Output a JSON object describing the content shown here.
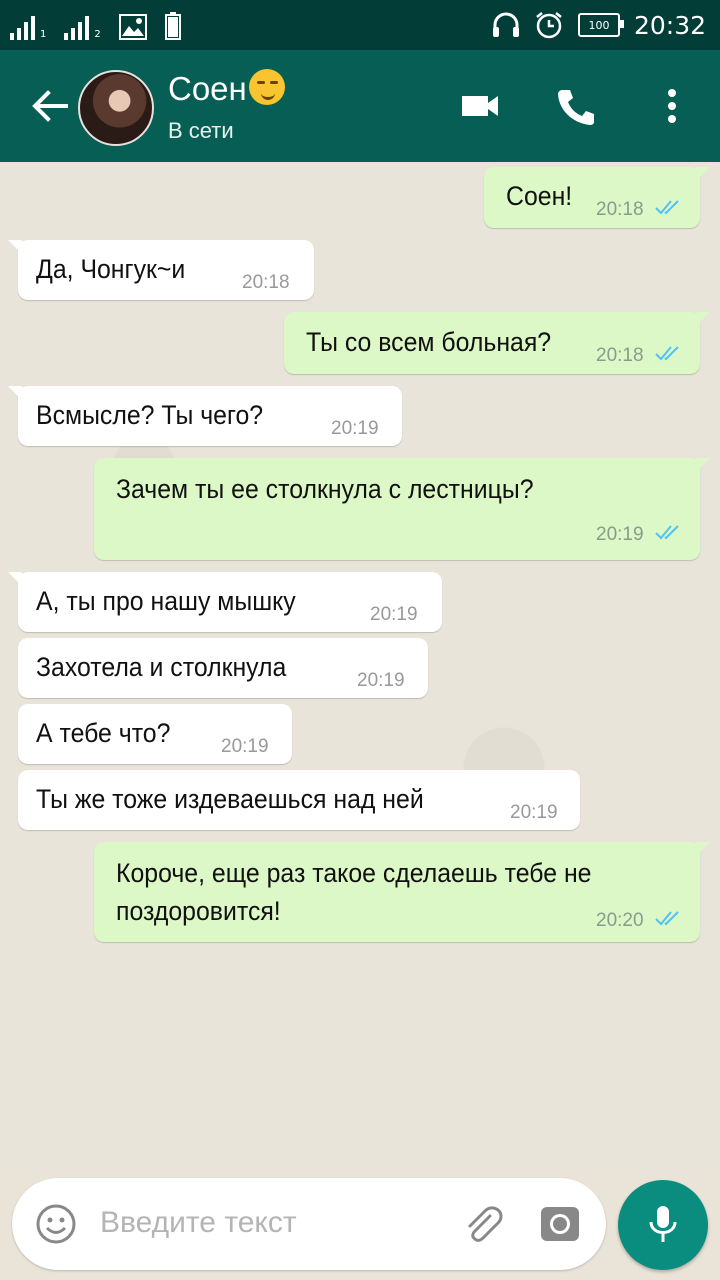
{
  "status_bar": {
    "time": "20:32",
    "battery": "100",
    "sim1": "1",
    "sim2": "2"
  },
  "header": {
    "contact_name": "Соен",
    "status": "В сети",
    "icons": [
      "back-arrow-icon",
      "video-call-icon",
      "phone-icon",
      "more-vert-icon"
    ]
  },
  "messages": [
    {
      "dir": "out",
      "text": "Соен!",
      "time": "20:18",
      "read": true
    },
    {
      "dir": "in",
      "text": "Да, Чонгук~и",
      "time": "20:18"
    },
    {
      "dir": "out",
      "text": "Ты со всем больная?",
      "time": "20:18",
      "read": true
    },
    {
      "dir": "in",
      "text": "Всмысле? Ты чего?",
      "time": "20:19"
    },
    {
      "dir": "out",
      "text": "Зачем ты ее столкнула с лестницы?",
      "time": "20:19",
      "read": true
    },
    {
      "dir": "in",
      "text": "А, ты про нашу мышку",
      "time": "20:19"
    },
    {
      "dir": "in",
      "text": "Захотела и столкнула",
      "time": "20:19"
    },
    {
      "dir": "in",
      "text": "А тебе что?",
      "time": "20:19"
    },
    {
      "dir": "in",
      "text": "Ты же тоже издеваешься над ней",
      "time": "20:19"
    },
    {
      "dir": "out",
      "text": "Короче, еще раз такое сделаешь тебе не поздоровится!",
      "time": "20:20",
      "read": true
    }
  ],
  "composer": {
    "placeholder": "Введите текст"
  },
  "colors": {
    "header": "#075e54",
    "status_bar": "#033d37",
    "outgoing_bubble": "#dcf8c6",
    "incoming_bubble": "#ffffff",
    "read_ticks": "#4fc3f7",
    "mic_button": "#0a8d7f"
  }
}
